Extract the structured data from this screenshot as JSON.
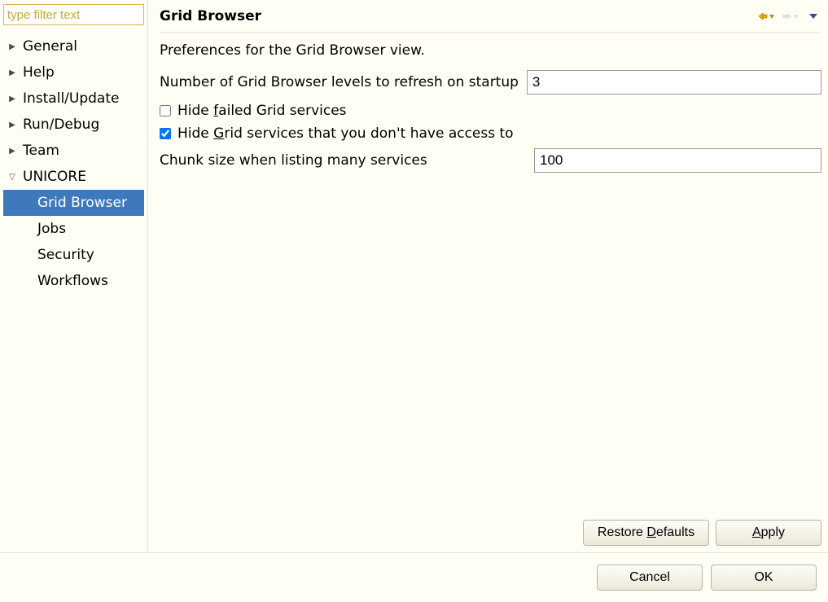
{
  "filter": {
    "placeholder": "type filter text"
  },
  "tree": {
    "items": [
      {
        "label": "General",
        "expanded": false
      },
      {
        "label": "Help",
        "expanded": false
      },
      {
        "label": "Install/Update",
        "expanded": false
      },
      {
        "label": "Run/Debug",
        "expanded": false
      },
      {
        "label": "Team",
        "expanded": false
      },
      {
        "label": "UNICORE",
        "expanded": true
      }
    ],
    "unicore_children": [
      {
        "label": "Grid Browser",
        "selected": true
      },
      {
        "label": "Jobs",
        "selected": false
      },
      {
        "label": "Security",
        "selected": false
      },
      {
        "label": "Workflows",
        "selected": false
      }
    ]
  },
  "panel": {
    "title": "Grid Browser",
    "description": "Preferences for the Grid Browser view.",
    "levels_label": "Number of Grid Browser levels to refresh on startup",
    "levels_value": "3",
    "hide_failed_label": "Hide failed Grid services",
    "hide_failed_checked": false,
    "hide_noaccess_label": "Hide Grid services that you don't have access to",
    "hide_noaccess_checked": true,
    "chunk_label": "Chunk size when listing many services",
    "chunk_value": "100",
    "restore_defaults": "Restore Defaults",
    "apply": "Apply"
  },
  "footer": {
    "cancel": "Cancel",
    "ok": "OK"
  }
}
